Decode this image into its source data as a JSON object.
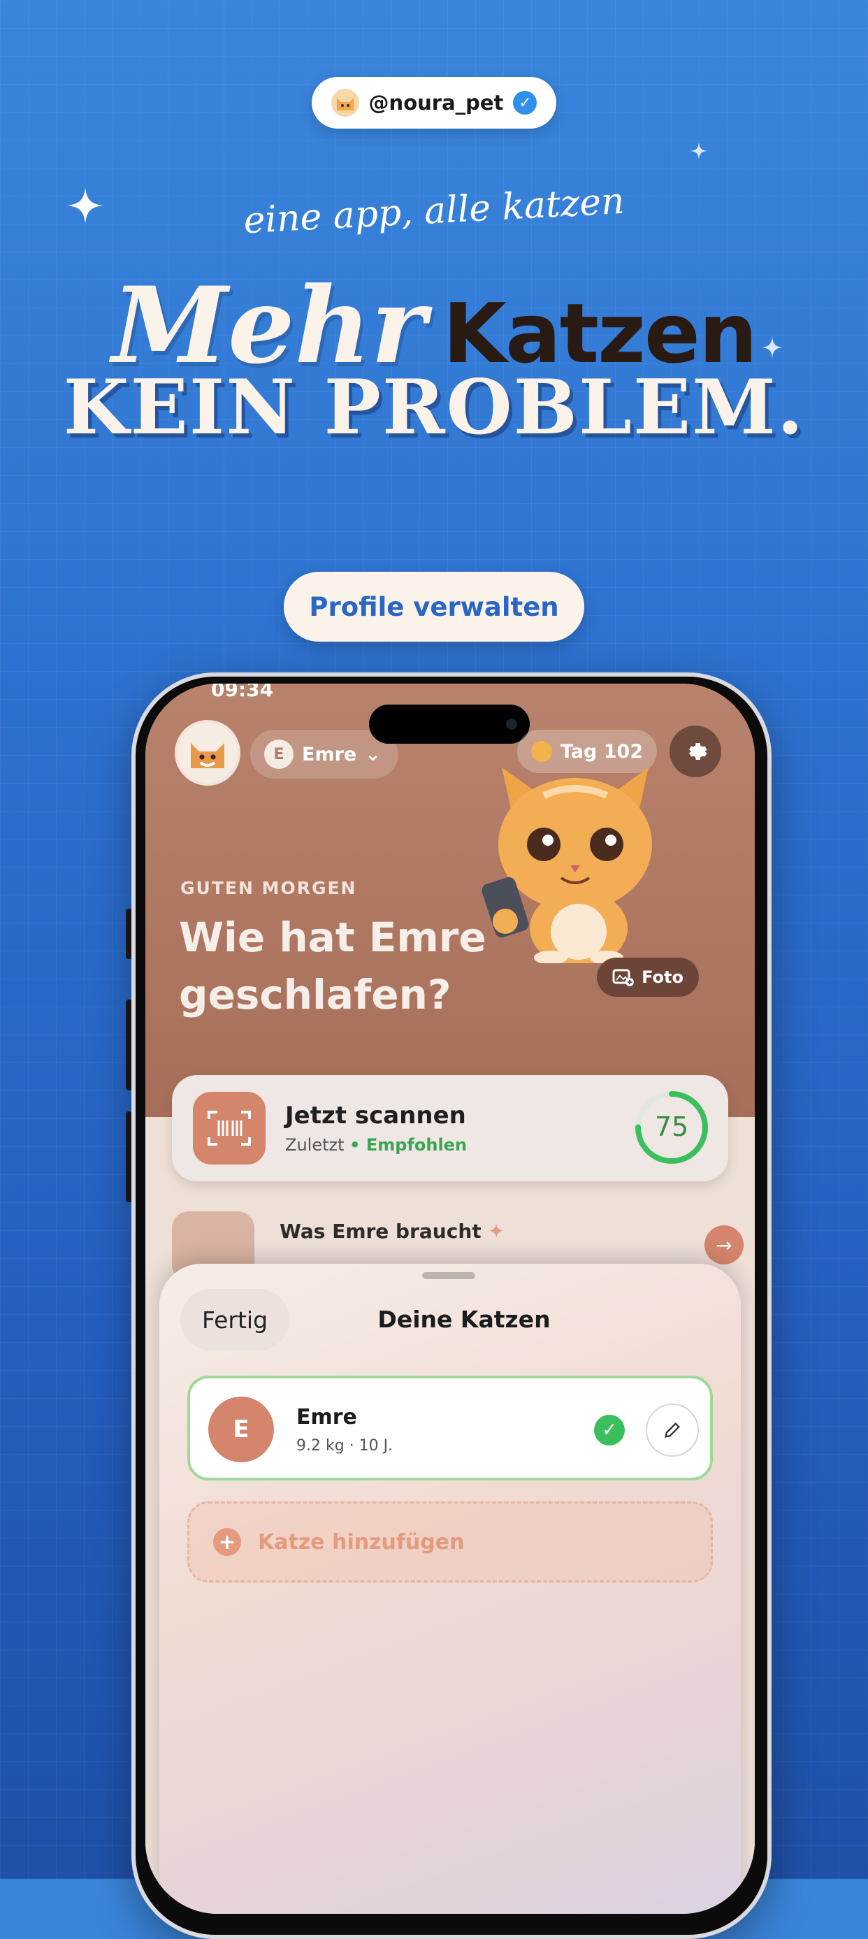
{
  "header": {
    "handle": "@noura_pet",
    "tagline": "eine app, alle katzen",
    "headline_part1": "Mehr",
    "headline_part2": "Katzen",
    "headline_line2": "KEIN PROBLEM.",
    "cta_label": "Profile verwalten"
  },
  "phone": {
    "status_time": "09:34",
    "topbar": {
      "cat_initial": "E",
      "cat_name": "Emre",
      "day_label": "Tag 102"
    },
    "greeting": {
      "small": "GUTEN MORGEN",
      "big": "Wie hat Emre geschlafen?"
    },
    "foto_label": "Foto",
    "scan_card": {
      "title": "Jetzt scannen",
      "sub_prefix": "Zuletzt",
      "sub_status": "• Empfohlen",
      "score": "75",
      "score_fraction": 0.75
    },
    "needs": {
      "title": "Was Emre braucht"
    },
    "sheet": {
      "done_label": "Fertig",
      "title": "Deine Katzen",
      "cats": [
        {
          "initial": "E",
          "name": "Emre",
          "meta": "9.2 kg · 10 J."
        }
      ],
      "add_label": "Katze hinzufügen"
    }
  },
  "colors": {
    "background": "#2d72d0",
    "accent": "#d4856b",
    "success": "#3bbf5c",
    "cta_text": "#2a66c4"
  },
  "icons": [
    "cat-avatar-icon",
    "verified-icon",
    "chevron-down-icon",
    "sun-icon",
    "gear-icon",
    "camera-add-icon",
    "barcode-scan-icon",
    "sparkle-icon",
    "arrow-right-icon",
    "checkmark-icon",
    "pencil-icon",
    "plus-icon"
  ]
}
